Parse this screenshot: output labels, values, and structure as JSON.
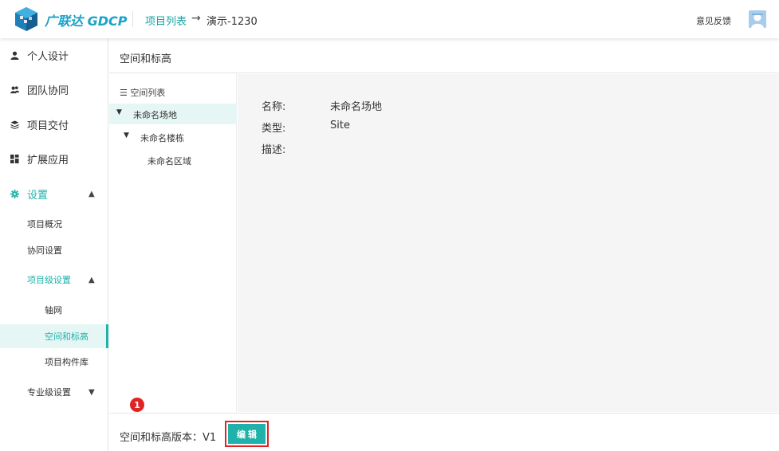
{
  "header": {
    "logo_text": "广联达",
    "logo_text_brand": "GDCP",
    "breadcrumb_link": "项目列表",
    "breadcrumb_arrow": "→",
    "breadcrumb_current": "演示-1230",
    "feedback_label": "意见反馈"
  },
  "sidebar": {
    "items": [
      {
        "label": "个人设计",
        "icon": "user-icon"
      },
      {
        "label": "团队协同",
        "icon": "team-icon"
      },
      {
        "label": "项目交付",
        "icon": "layers-icon"
      },
      {
        "label": "扩展应用",
        "icon": "apps-icon"
      },
      {
        "label": "设置",
        "icon": "gear-icon",
        "expanded": true
      }
    ],
    "settings_children": [
      {
        "label": "项目概况"
      },
      {
        "label": "协同设置"
      },
      {
        "label": "项目级设置",
        "expanded": true
      }
    ],
    "project_level_children": [
      {
        "label": "轴网"
      },
      {
        "label": "空间和标高",
        "selected": true
      },
      {
        "label": "项目构件库"
      }
    ],
    "professional_settings": {
      "label": "专业级设置",
      "expanded": false
    }
  },
  "content": {
    "title": "空间和标高",
    "tree_header": "☰ 空间列表",
    "tree": [
      {
        "label": "未命名场地",
        "level": 0,
        "selected": true,
        "expanded": true
      },
      {
        "label": "未命名楼栋",
        "level": 1,
        "expanded": true
      },
      {
        "label": "未命名区域",
        "level": 2
      }
    ],
    "details": {
      "name_label": "名称:",
      "name_value": "未命名场地",
      "type_label": "类型:",
      "type_value": "Site",
      "desc_label": "描述:",
      "desc_value": ""
    }
  },
  "footer": {
    "version_text": "空间和标高版本：V1",
    "edit_button": "编 辑",
    "step_badge": "1"
  },
  "colors": {
    "accent": "#20b2aa",
    "highlight": "#e02424",
    "logo_blue": "#1aa3c8",
    "detail_bg": "#f5f5f5"
  }
}
